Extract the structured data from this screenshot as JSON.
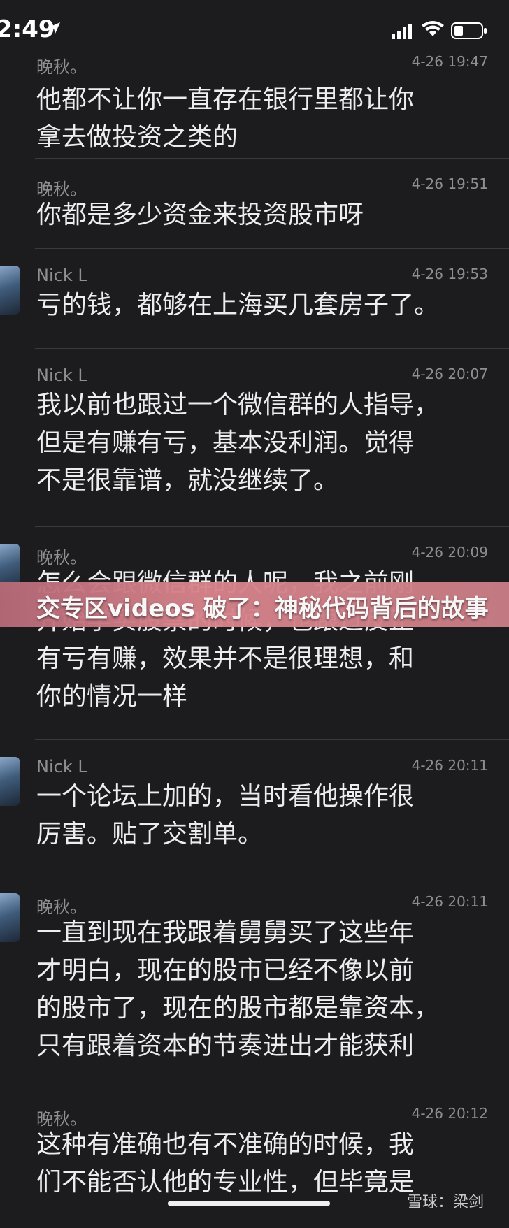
{
  "status_bar": {
    "time": "2:49"
  },
  "messages": [
    {
      "name": "晚秋。",
      "time": "4-26 19:47",
      "text": [
        "他都不让你一直存在银行里都让你",
        "拿去做投资之类的"
      ]
    },
    {
      "name": "晚秋。",
      "time": "4-26 19:51",
      "text": [
        "你都是多少资金来投资股市呀"
      ]
    },
    {
      "name": "Nick L",
      "time": "4-26 19:53",
      "text": [
        "亏的钱，都够在上海买几套房子了。"
      ]
    },
    {
      "name": "Nick L",
      "time": "4-26 20:07",
      "text": [
        "我以前也跟过一个微信群的人指导，",
        "但是有赚有亏，基本没利润。觉得",
        "不是很靠谱，就没继续了。"
      ]
    },
    {
      "name": "晚秋。",
      "time": "4-26 20:09",
      "text": [
        "怎么会跟微信群的人呢，我之前刚",
        "开始学买股票的时候，也跟过反正",
        "有亏有赚，效果并不是很理想，和",
        "你的情况一样"
      ]
    },
    {
      "name": "Nick L",
      "time": "4-26 20:11",
      "text": [
        "一个论坛上加的，当时看他操作很",
        "厉害。贴了交割单。"
      ]
    },
    {
      "name": "晚秋。",
      "time": "4-26 20:11",
      "text": [
        "一直到现在我跟着舅舅买了这些年",
        "才明白，现在的股市已经不像以前",
        "的股市了，现在的股市都是靠资本，",
        "只有跟着资本的节奏进出才能获利"
      ]
    },
    {
      "name": "晚秋。",
      "time": "4-26 20:12",
      "text": [
        "这种有准确也有不准确的时候，我",
        "们不能否认他的专业性，但毕竟是"
      ]
    }
  ],
  "banner": {
    "text": "交专区videos 破了：神秘代码背后的故事"
  },
  "watermark": {
    "text": "雪球：梁剑"
  }
}
